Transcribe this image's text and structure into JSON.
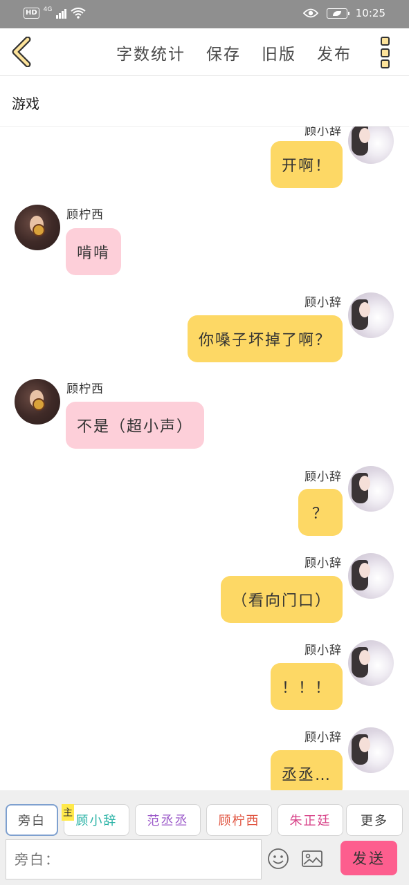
{
  "status_bar": {
    "hd": "HD",
    "network": "4G",
    "time": "10:25",
    "icons": [
      "hd-icon",
      "signal-icon",
      "wifi-icon",
      "eye-icon",
      "battery-icon"
    ]
  },
  "toolbar": {
    "back_icon": "chevron-left-icon",
    "actions": [
      "字数统计",
      "保存",
      "旧版",
      "发布"
    ],
    "more_icon": "vertical-dots-icon"
  },
  "title": "游戏",
  "characters": {
    "right": "顾小辞",
    "left": "顾柠西"
  },
  "messages": [
    {
      "side": "right",
      "name": "顾小辞",
      "text": "开啊！"
    },
    {
      "side": "left",
      "name": "顾柠西",
      "text": "啃啃"
    },
    {
      "side": "right",
      "name": "顾小辞",
      "text": "你嗓子坏掉了啊？"
    },
    {
      "side": "left",
      "name": "顾柠西",
      "text": "不是（超小声）"
    },
    {
      "side": "right",
      "name": "顾小辞",
      "text": "？"
    },
    {
      "side": "right",
      "name": "顾小辞",
      "text": "（看向门口）"
    },
    {
      "side": "right",
      "name": "顾小辞",
      "text": "！！！"
    },
    {
      "side": "right",
      "name": "顾小辞",
      "text": "丞丞…"
    }
  ],
  "bottom": {
    "roles": [
      {
        "label": "旁白",
        "color": "#555555"
      },
      {
        "label": "顾小辞",
        "color": "#2ab3a6"
      },
      {
        "label": "范丞丞",
        "color": "#9b59c9"
      },
      {
        "label": "顾柠西",
        "color": "#e0533f"
      },
      {
        "label": "朱正廷",
        "color": "#d8458a"
      },
      {
        "label": "更多",
        "color": "#444444"
      }
    ],
    "main_tag": "主",
    "input_placeholder": "旁白：",
    "emoji_icon": "emoji-icon",
    "image_icon": "image-icon",
    "send_label": "发送"
  },
  "colors": {
    "right_bubble": "#fdd865",
    "left_bubble": "#fdcfd9",
    "send_button": "#fd5e8e",
    "status_bar": "#8f8f8f"
  }
}
